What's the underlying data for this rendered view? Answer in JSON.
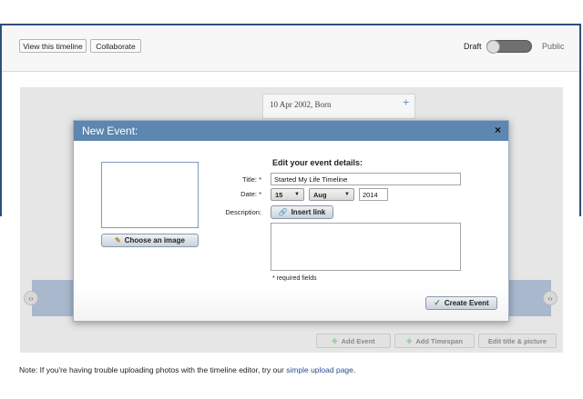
{
  "toolbar": {
    "view_timeline": "View this timeline",
    "collaborate": "Collaborate",
    "draft": "Draft",
    "public": "Public"
  },
  "timeline": {
    "event_card_label": "10 Apr 2002, Born",
    "add_event": "Add Event",
    "add_timespan": "Add Timespan",
    "edit_title_picture": "Edit title & picture"
  },
  "modal": {
    "title": "New Event:",
    "close": "×",
    "heading": "Edit your event details:",
    "choose_image": "Choose an image",
    "title_label": "Title: *",
    "title_value": "Started My Life Timeline",
    "date_label": "Date: *",
    "day": "15",
    "month": "Aug",
    "year": "2014",
    "description_label": "Description:",
    "insert_link": "Insert link",
    "required_note": "* required fields",
    "create_event": "Create Event"
  },
  "footer": {
    "note_prefix": "Note: If you're having trouble uploading photos with the timeline editor, try our ",
    "link": "simple upload page",
    "note_suffix": "."
  },
  "colors": {
    "modal_header": "#5d86b0",
    "frame_border": "#2f4f7a",
    "timeline_band": "#a9b8cd"
  }
}
